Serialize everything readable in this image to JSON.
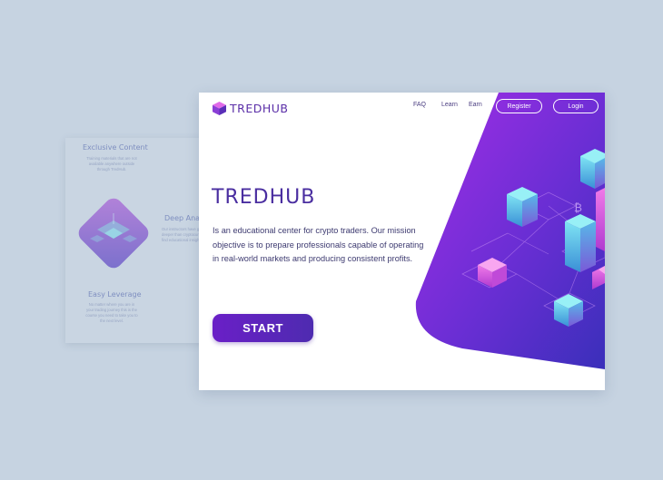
{
  "background_panel": {
    "features": [
      {
        "title": "Exclusive Content",
        "desc": "Training materials that are not available anywhere outside through TredHub."
      },
      {
        "title": "Deep Analysis",
        "desc": "Our instructors have gone far deeper than cryptocurrency to find educational insights."
      },
      {
        "title": "Easy Leverage",
        "desc": "No matter where you are in your trading journey this is the course you need to take you to the next level."
      }
    ]
  },
  "header": {
    "logo_text": "TREDHUB",
    "nav": {
      "faq": "FAQ",
      "learn": "Learn",
      "earn": "Earn"
    },
    "register_label": "Register",
    "login_label": "Login"
  },
  "hero": {
    "title": "TREDHUB",
    "description": "Is an educational center for crypto traders. Our mission objective is to prepare professionals capable of operating in real-world markets and producing consistent profits.",
    "cta_label": "START"
  },
  "colors": {
    "accent_purple": "#5b2fa8",
    "gradient_start": "#8a2fe0",
    "gradient_end": "#3b2db8",
    "page_background": "#c6d3e1"
  },
  "icons": {
    "logo": "purple-cube-icon",
    "illustration": "isometric-blockchain-illustration",
    "bitcoin": "bitcoin-icon"
  }
}
